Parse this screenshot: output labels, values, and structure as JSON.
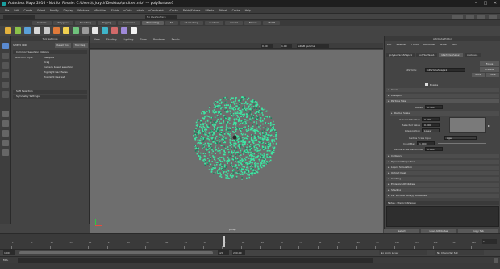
{
  "window": {
    "title": "Autodesk Maya 2016 - Not for Resale: C:\\Users\\t_kayth\\Desktop\\untitled.mb* --- polySurface1",
    "minimize": "–",
    "maximize": "□",
    "close": "✕"
  },
  "menubar": {
    "items": [
      "File",
      "Edit",
      "Create",
      "Select",
      "Modify",
      "Display",
      "Windows",
      "nParticles",
      "Fluids",
      "nCloth",
      "nHair",
      "nConstraint",
      "nCache",
      "Fields/Solvers",
      "Effects",
      "Bifrost",
      "Cache",
      "Help"
    ]
  },
  "shelf": {
    "tabs": [
      {
        "label": "Custom"
      },
      {
        "label": "Polygons"
      },
      {
        "label": "Sculpting"
      },
      {
        "label": "Rigging"
      },
      {
        "label": "Animation"
      },
      {
        "label": "Rendering"
      },
      {
        "label": "FX"
      },
      {
        "label": "FX Caching"
      },
      {
        "label": "Custom"
      },
      {
        "label": "Arnold"
      },
      {
        "label": "Bifrost"
      },
      {
        "label": "MASH"
      }
    ],
    "active_index": 5,
    "icon_colors": [
      "#e3b13d",
      "#8ac24a",
      "#5aa0d8",
      "#d8d8d8",
      "#c9c9c9",
      "#e07a3a",
      "#f0d050",
      "#6fc27c",
      "#9a9a9a",
      "#e7e7e7",
      "#3fb5c9",
      "#d26a6a",
      "#9f8ad9",
      "#f2f2f2"
    ],
    "status_field": "No Live Surface"
  },
  "toolbox": {
    "icons": [
      "select-icon",
      "lasso-icon",
      "paint-select-icon",
      "move-icon",
      "rotate-icon",
      "scale-icon"
    ]
  },
  "tool_settings": {
    "header": "Tool Settings",
    "tool_name": "Select Tool",
    "reset_label": "Reset Tool",
    "help_label": "Tool Help",
    "sections": [
      "Common Selection Options",
      "Soft Selection",
      "Symmetry Settings"
    ],
    "options": [
      {
        "label": "Selection Style:",
        "value": "Marquee"
      },
      {
        "label": "",
        "value": "Drag"
      },
      {
        "label": "",
        "value": "Camera based selection"
      },
      {
        "label": "",
        "value": "Highlight Backfaces"
      },
      {
        "label": "",
        "value": "Highlight Nearest"
      }
    ]
  },
  "viewport": {
    "menu": [
      "View",
      "Shading",
      "Lighting",
      "Show",
      "Renderer",
      "Panels"
    ],
    "camera_label": "persp",
    "exposure": "0.00",
    "gamma": "1.00",
    "colorspace": "sRGB gamma",
    "particle_color": "#3ee6a3",
    "background": "#6e6e6e"
  },
  "attribute_editor": {
    "header": "Attribute Editor",
    "menu": [
      "List",
      "Selected",
      "Focus",
      "Attributes",
      "Show",
      "Help"
    ],
    "tabs": [
      "polySurfaceShape1",
      "polySurface1",
      "nParticleShape1",
      "nucleus1"
    ],
    "node_label": "nParticle:",
    "node_value": "nParticleShape1",
    "focus_label": "Focus",
    "presets_label": "Presets",
    "show_label": "Show",
    "hide_label": "Hide",
    "enable_label": "Enable",
    "sections": [
      {
        "label": "Count"
      },
      {
        "label": "Lifespan"
      },
      {
        "label": "Particle Size"
      }
    ],
    "radius_label": "Radius",
    "radius_value": "0.300",
    "radius_scale_section": "Radius Scale",
    "selected_position_label": "Selected Position",
    "selected_position": "0.000",
    "selected_value_label": "Selected Value",
    "selected_value": "0.000",
    "interpolation_label": "Interpolation",
    "interpolation": "Linear",
    "radius_scale_input_label": "Radius Scale Input",
    "radius_scale_input": "Age",
    "input_max_label": "Input Max",
    "input_max": "1.000",
    "randomize_label": "Radius Scale Randomize",
    "randomize": "0.000",
    "more_sections": [
      "Collisions",
      "Dynamic Properties",
      "Liquid Simulation",
      "Output Mesh",
      "Caching",
      "Emission Attributes",
      "Shading",
      "Per Particle (Array) Attributes"
    ],
    "notes_label": "Notes: nParticleShape1",
    "select_label": "Select",
    "load_label": "Load Attributes",
    "copy_label": "Copy Tab"
  },
  "timeline": {
    "ticks": [
      "1",
      "5",
      "10",
      "15",
      "20",
      "25",
      "30",
      "35",
      "40",
      "45",
      "50",
      "55",
      "60",
      "65",
      "70",
      "75",
      "80",
      "85",
      "90",
      "95",
      "100",
      "105",
      "110",
      "115",
      "120"
    ],
    "current_frame": "1",
    "start": "1.00",
    "end": "120",
    "range_end": "200.00",
    "anim_layer": "No Anim Layer",
    "char_set": "No Character Set"
  },
  "command_line": {
    "lang": "MEL",
    "help": ""
  }
}
